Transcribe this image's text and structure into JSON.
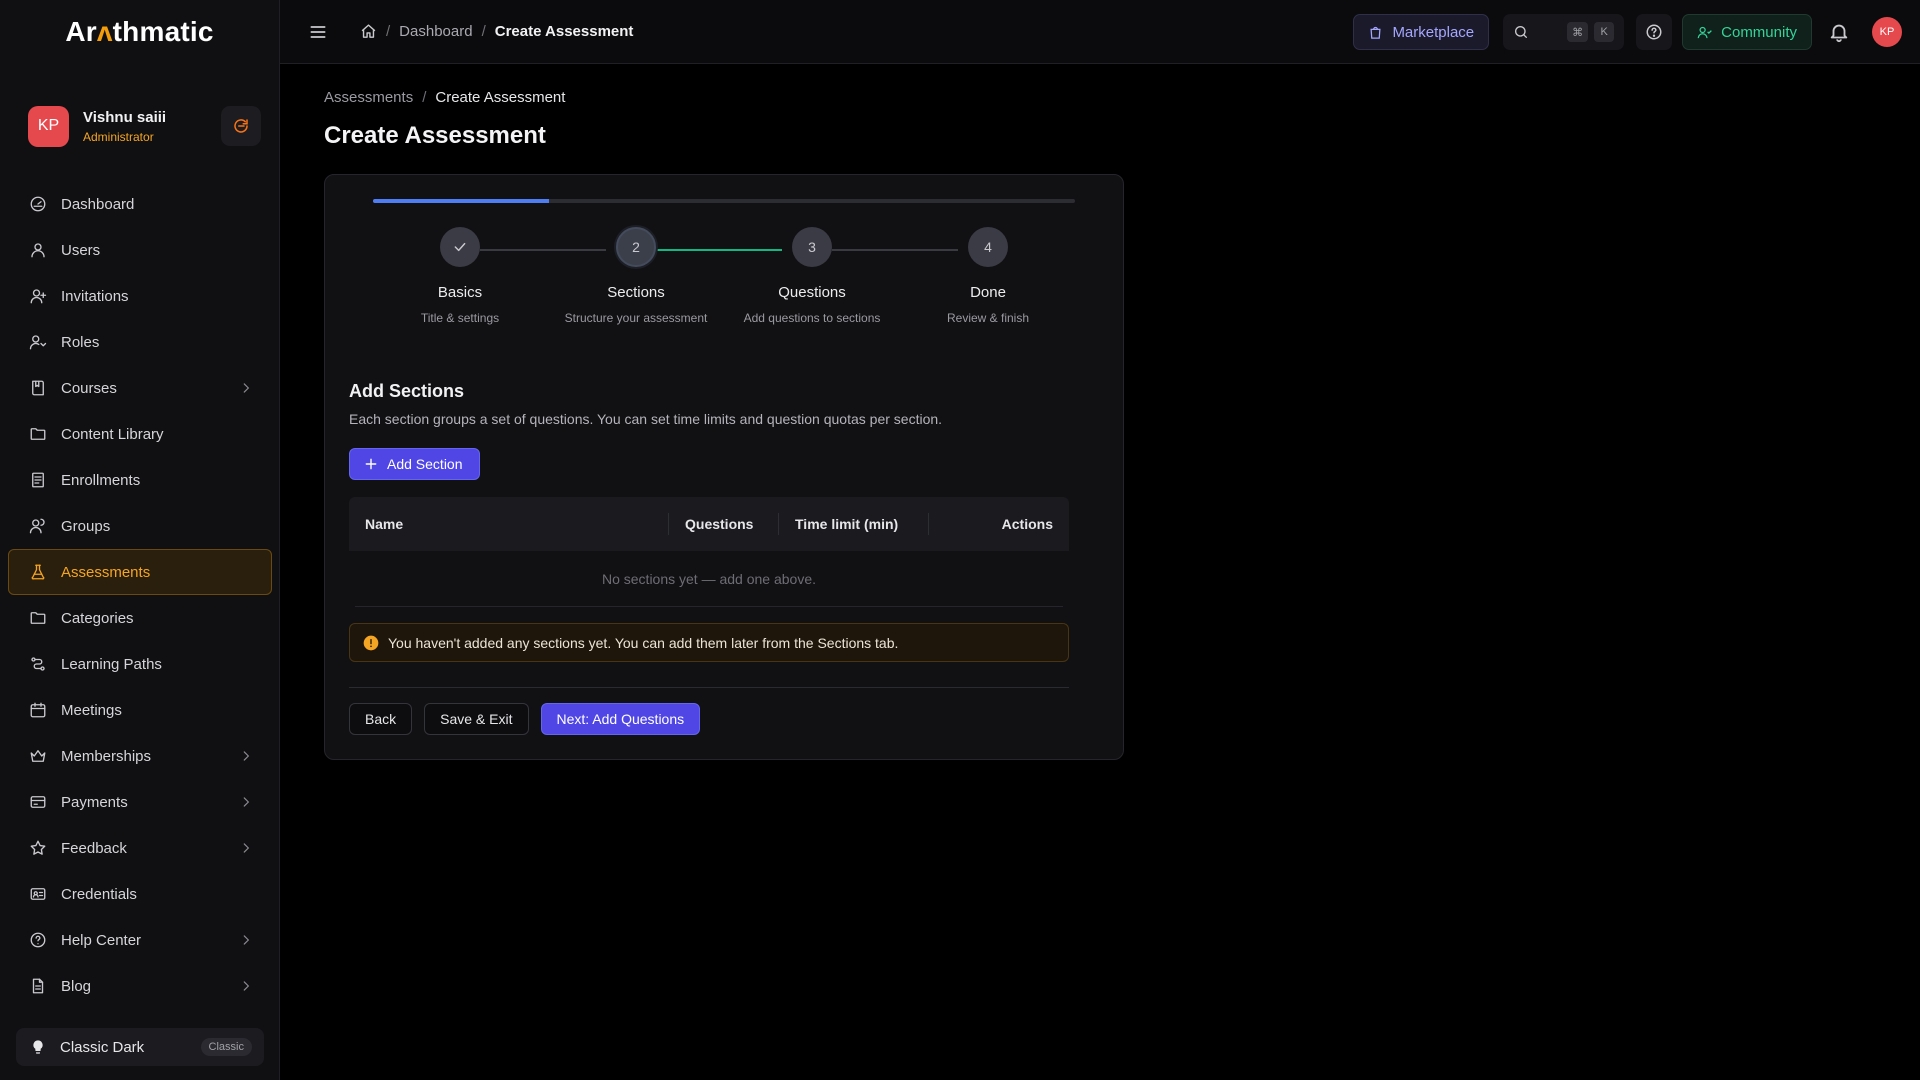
{
  "app": {
    "logo_pre": "Ar",
    "logo_accent": "ʌ",
    "logo_post": "thmatic"
  },
  "user": {
    "initials": "KP",
    "name": "Vishnu saiii",
    "role": "Administrator"
  },
  "sidebar": {
    "items": [
      {
        "label": "Dashboard",
        "icon": "dashboard-icon",
        "chevron": false
      },
      {
        "label": "Users",
        "icon": "user-icon",
        "chevron": false
      },
      {
        "label": "Invitations",
        "icon": "user-plus-icon",
        "chevron": false
      },
      {
        "label": "Roles",
        "icon": "roles-icon",
        "chevron": false
      },
      {
        "label": "Courses",
        "icon": "book-icon",
        "chevron": true
      },
      {
        "label": "Content Library",
        "icon": "folder-icon",
        "chevron": false
      },
      {
        "label": "Enrollments",
        "icon": "list-icon",
        "chevron": false
      },
      {
        "label": "Groups",
        "icon": "group-icon",
        "chevron": false
      },
      {
        "label": "Assessments",
        "icon": "flask-icon",
        "chevron": false,
        "active": true
      },
      {
        "label": "Categories",
        "icon": "folder-icon",
        "chevron": false
      },
      {
        "label": "Learning Paths",
        "icon": "route-icon",
        "chevron": false
      },
      {
        "label": "Meetings",
        "icon": "calendar-icon",
        "chevron": false
      },
      {
        "label": "Memberships",
        "icon": "crown-icon",
        "chevron": true
      },
      {
        "label": "Payments",
        "icon": "card-icon",
        "chevron": true
      },
      {
        "label": "Feedback",
        "icon": "star-icon",
        "chevron": true
      },
      {
        "label": "Credentials",
        "icon": "id-card-icon",
        "chevron": false
      },
      {
        "label": "Help Center",
        "icon": "help-circle-icon",
        "chevron": true
      },
      {
        "label": "Blog",
        "icon": "document-icon",
        "chevron": true
      }
    ],
    "theme_label": "Classic Dark",
    "theme_badge": "Classic"
  },
  "topbar": {
    "breadcrumb": [
      "Dashboard",
      "Create Assessment"
    ],
    "marketplace": "Marketplace",
    "kbd_1": "⌘",
    "kbd_2": "K",
    "community": "Community",
    "avatar": "KP"
  },
  "page": {
    "breadcrumb": [
      "Assessments",
      "Create Assessment"
    ],
    "title": "Create Assessment",
    "progress": 0.25
  },
  "steps": [
    {
      "number": "1",
      "title": "Basics",
      "sub": "Title & settings",
      "state": "done"
    },
    {
      "number": "2",
      "title": "Sections",
      "sub": "Structure your assessment",
      "state": "current"
    },
    {
      "number": "3",
      "title": "Questions",
      "sub": "Add questions to sections",
      "state": "pending"
    },
    {
      "number": "4",
      "title": "Done",
      "sub": "Review & finish",
      "state": "pending"
    }
  ],
  "sections": {
    "title": "Add Sections",
    "description": "Each section groups a set of questions. You can set time limits and question quotas per section.",
    "add_button": "Add Section",
    "columns": [
      "Name",
      "Questions",
      "Time limit (min)",
      "Actions"
    ],
    "empty": "No sections yet — add one above.",
    "warning": "You haven't added any sections yet. You can add them later from the Sections tab."
  },
  "actions": {
    "back": "Back",
    "save_exit": "Save & Exit",
    "next": "Next: Add Questions"
  },
  "colors": {
    "accent": "#f5a524",
    "primary": "#4f46e5",
    "progress": "#4f7df3",
    "success": "#10b981"
  }
}
